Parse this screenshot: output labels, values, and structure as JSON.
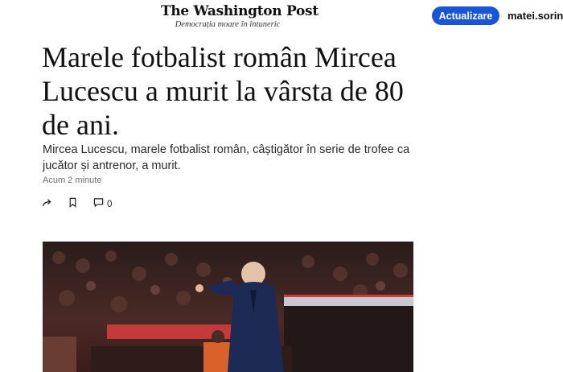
{
  "masthead": {
    "logo_text": "The Washington Post",
    "tagline": "Democrația moare în întuneric"
  },
  "header": {
    "update_button_label": "Actualizare",
    "username": "matei.sorina"
  },
  "article": {
    "headline": "Marele fotbalist român Mircea Lucescu a murit la vârsta de 80 de ani.",
    "subheadline": "Mircea Lucescu, marele fotbalist român, câștigător în serie de trofee ca jucător și antrenor, a murit.",
    "timestamp": "Acum 2 minute",
    "comment_count": "0"
  },
  "icons": {
    "share": "share-arrow-icon",
    "bookmark": "bookmark-icon",
    "comments": "comment-bubble-icon"
  },
  "colors": {
    "accent": "#1955d6"
  }
}
